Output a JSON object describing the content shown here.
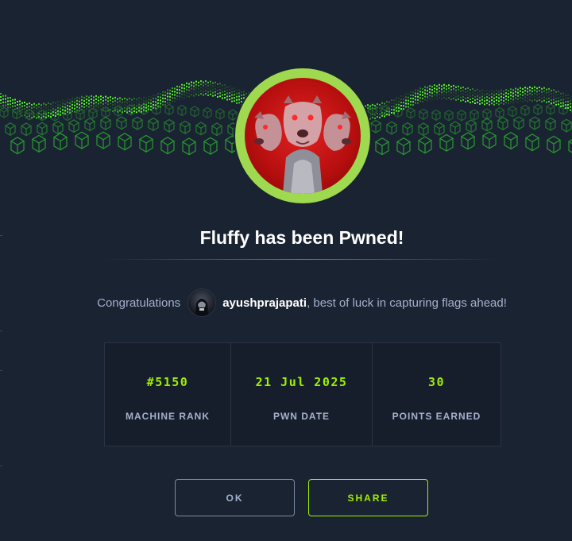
{
  "modal": {
    "title": "Fluffy has been Pwned!",
    "machine_image": "cerberus-three-headed-dog-icon",
    "congrats_prefix": "Congratulations",
    "username": "ayushprajapati",
    "congrats_suffix": ", best of luck in capturing flags ahead!",
    "stats": [
      {
        "value": "#5150",
        "label": "MACHINE RANK"
      },
      {
        "value": "21 Jul 2025",
        "label": "PWN DATE"
      },
      {
        "value": "30",
        "label": "POINTS EARNED"
      }
    ],
    "buttons": {
      "ok": "OK",
      "share": "SHARE"
    }
  },
  "colors": {
    "accent": "#9fef00",
    "ring": "#9fd94f",
    "background": "#1a2332",
    "machine_bg": "#d11818",
    "text_muted": "#a4b1cd"
  }
}
